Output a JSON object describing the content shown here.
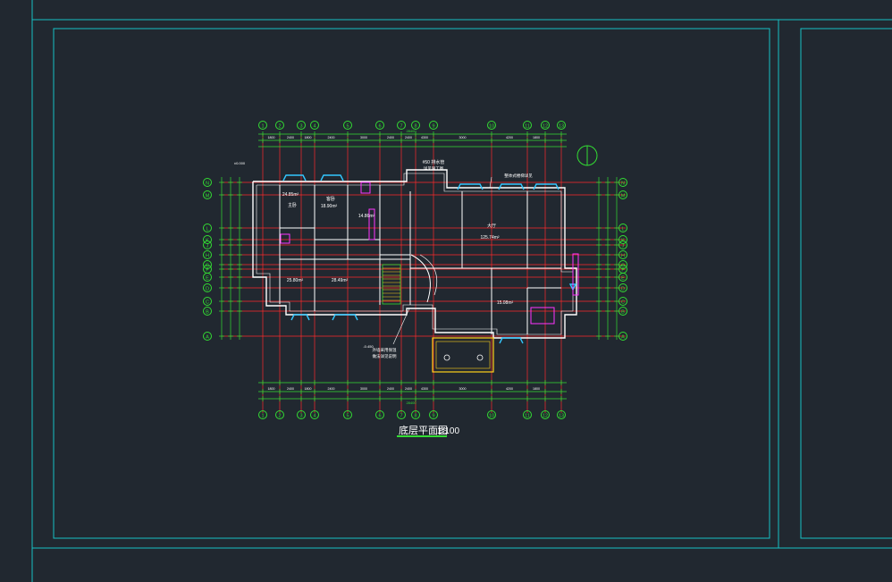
{
  "colors": {
    "background": "#212830",
    "frame": "#16c0c4",
    "wall": "#ffffff",
    "axis": "#ff2a2a",
    "dimension": "#33dd33",
    "magenta": "#ff33ff",
    "window": "#33c7ff",
    "yellow": "#ffd21a"
  },
  "drawing": {
    "title": "底层平面图",
    "scale": "1:100"
  },
  "axes": {
    "top": [
      "1",
      "2",
      "3",
      "4",
      "5",
      "6",
      "7",
      "8",
      "9",
      "10",
      "11",
      "12",
      "13"
    ],
    "side": [
      "N",
      "M",
      "L",
      "K",
      "J",
      "H",
      "G",
      "F",
      "E",
      "D",
      "C",
      "B",
      "A"
    ]
  },
  "dims": {
    "overall": "28400",
    "top_row": [
      "1800",
      "2400",
      "1800",
      "2400",
      "3000",
      "2400",
      "2400",
      "4300",
      "3000",
      "4200",
      "1800"
    ],
    "bottom_row": [
      "1800",
      "2400",
      "1800",
      "2400",
      "3000",
      "2400",
      "2400",
      "4300",
      "3000",
      "4200",
      "1800"
    ]
  },
  "rooms": {
    "big_hall_name": "大厅",
    "big_hall_area": "125.74m²",
    "room_a_area": "24.85m²",
    "room_a_name": "主卧",
    "room_b_area": "18.90m²",
    "room_b_name": "客卧",
    "room_c_area": "14.86m²",
    "room_d_area": "25.80m²",
    "room_e_area": "28.49m²",
    "room_f_area": "15.08m²"
  },
  "notes": {
    "top_note": "#50 排水管",
    "top_note2": "详见施工图",
    "right_note": "整体式楼梯详见",
    "bottom_note": "外墙采用保温",
    "bottom_note2": "做法详见说明"
  },
  "levels": {
    "top_left": "±0.000",
    "mid": "-0.450"
  }
}
